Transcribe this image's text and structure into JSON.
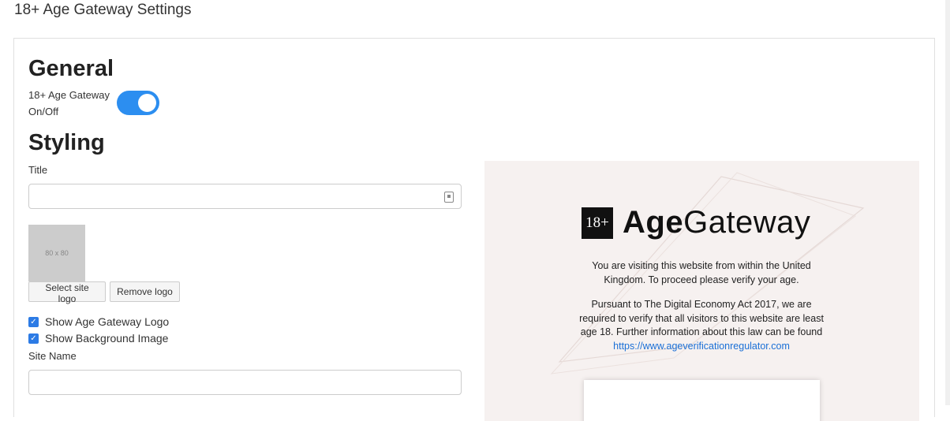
{
  "page": {
    "title": "18+ Age Gateway Settings"
  },
  "general": {
    "heading": "General",
    "toggle_label": "18+ Age Gateway On/Off",
    "toggle_on": true
  },
  "styling": {
    "heading": "Styling",
    "title_label": "Title",
    "title_value": "",
    "logo_placeholder": "80 x 80",
    "select_logo": "Select site logo",
    "remove_logo": "Remove logo",
    "show_logo_label": "Show Age Gateway Logo",
    "show_logo_checked": true,
    "show_bg_label": "Show Background Image",
    "show_bg_checked": true,
    "site_name_label": "Site Name",
    "site_name_value": ""
  },
  "preview": {
    "badge": "18+",
    "brand_bold": "Age",
    "brand_light": "Gateway",
    "para1": "You are visiting this website from within the United Kingdom. To proceed please verify your age.",
    "para2": "Pursuant to The Digital Economy Act 2017, we are required to verify that all visitors to this website are least age 18. Further information about this law can be found",
    "link": "https://www.ageverificationregulator.com",
    "bg_color": "#f6f1f0"
  },
  "colors": {
    "accent": "#2c8ef0",
    "checkbox": "#2c7be5",
    "link": "#1a6fd6"
  }
}
